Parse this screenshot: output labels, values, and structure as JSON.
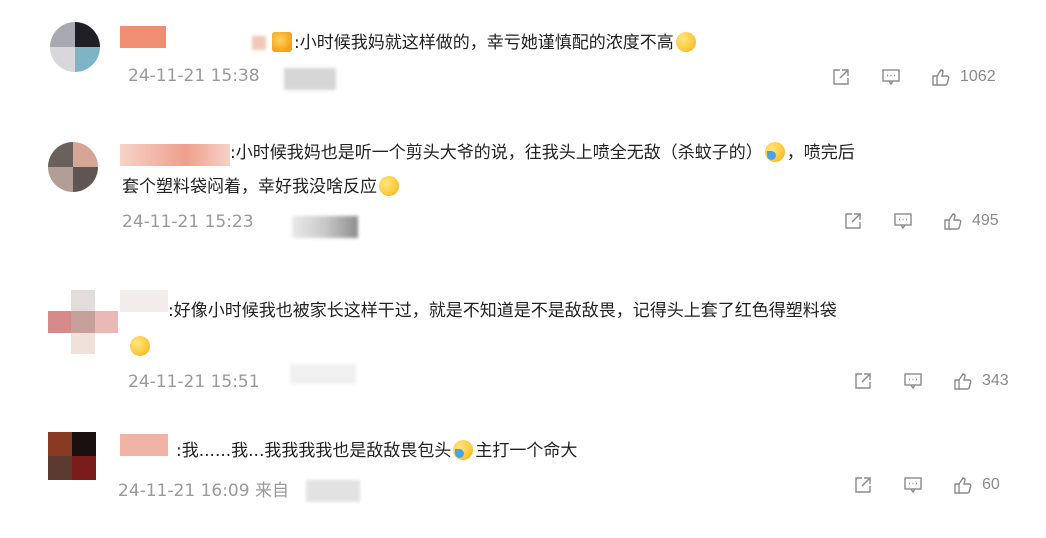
{
  "comments": [
    {
      "prefix": ":",
      "text": "小时候我妈就这样做的，幸亏她谨慎配的浓度不高",
      "time": "24-11-21 15:38",
      "likes": "1062"
    },
    {
      "prefix": ":",
      "text_line1": "小时候我妈也是听一个剪头大爷的说，往我头上喷全无敌（杀蚊子的）",
      "text_line1_tail": "，喷完后",
      "text_line2": "套个塑料袋闷着，幸好我没啥反应",
      "time": "24-11-21 15:23",
      "likes": "495"
    },
    {
      "prefix": ":",
      "text": "好像小时候我也被家长这样干过，就是不知道是不是敌敌畏，记得头上套了红色得塑料袋",
      "time": "24-11-21 15:51",
      "likes": "343"
    },
    {
      "prefix": ":",
      "text": "我......我...我我我我也是敌敌畏包头",
      "text_tail": "主打一个命大",
      "time": "24-11-21 16:09",
      "source": "来自",
      "likes": "60"
    }
  ],
  "icons": {
    "share": "share-icon",
    "comment": "comment-icon",
    "like": "thumbs-up-icon"
  }
}
